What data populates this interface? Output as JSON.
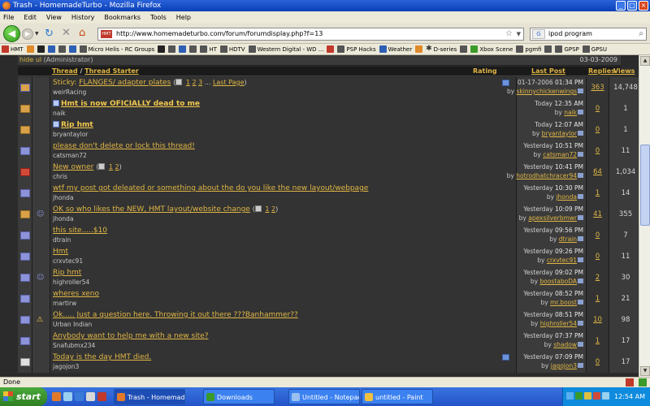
{
  "window": {
    "title": "Trash - HomemadeTurbo - Mozilla Firefox"
  },
  "menu": [
    "File",
    "Edit",
    "View",
    "History",
    "Bookmarks",
    "Tools",
    "Help"
  ],
  "nav": {
    "url": "http://www.homemadeturbo.com/forum/forumdisplay.php?f=13",
    "favicon_text": "HMT",
    "search_value": "ipod program",
    "search_engine": "G"
  },
  "bookmarks": [
    {
      "label": "HMT",
      "icon": "red"
    },
    {
      "label": "",
      "icon": "orange"
    },
    {
      "label": "",
      "icon": "dark"
    },
    {
      "label": "",
      "icon": "blue"
    },
    {
      "label": "",
      "icon": "sq"
    },
    {
      "label": "",
      "icon": "blue"
    },
    {
      "label": "Micro Helis - RC Groups",
      "icon": "sq"
    },
    {
      "label": "",
      "icon": "dark"
    },
    {
      "label": "",
      "icon": "sq"
    },
    {
      "label": "",
      "icon": "blue"
    },
    {
      "label": "",
      "icon": "sq"
    },
    {
      "label": "HT",
      "icon": "sq"
    },
    {
      "label": "HDTV",
      "icon": "sq"
    },
    {
      "label": "Western Digital - WD ...",
      "icon": "sq"
    },
    {
      "label": "",
      "icon": "red"
    },
    {
      "label": "PSP Hacks",
      "icon": "sq"
    },
    {
      "label": "Weather",
      "icon": "blue"
    },
    {
      "label": "",
      "icon": "orange"
    },
    {
      "label": "D-series",
      "icon": "star"
    },
    {
      "label": "",
      "icon": "sq"
    },
    {
      "label": "Xbox Scene",
      "icon": "green"
    },
    {
      "label": "pgmfi",
      "icon": "sq"
    },
    {
      "label": "",
      "icon": "sq"
    },
    {
      "label": "GPSP",
      "icon": "sq"
    },
    {
      "label": "GPSU",
      "icon": "sq"
    }
  ],
  "forum": {
    "admin_text": "(Administrator)",
    "date": "03-03-2009",
    "headers": {
      "thread": "Thread",
      "sep": " / ",
      "thread_starter": "Thread Starter",
      "rating": "Rating",
      "last_post": "Last Post",
      "replies": "Replies",
      "views": "Views"
    },
    "threads": [
      {
        "icon": "sticky",
        "prefix": "Sticky: ",
        "title": "FLANGES/ adapter plates",
        "bold": false,
        "check": false,
        "pages": [
          "1",
          "2",
          "3",
          "...",
          "Last Page"
        ],
        "starter": "weirRacing",
        "date": "01-17-2006",
        "time": "01:34 PM",
        "by": "skinnychickenwings",
        "replies": "363",
        "views": "14,748",
        "rating_icon": true,
        "post_icon": ""
      },
      {
        "icon": "hot",
        "prefix": "",
        "title": "Hmt is now OFICIALLY dead to me",
        "bold": true,
        "check": true,
        "pages": [],
        "starter": "naik",
        "date": "Today",
        "time": "12:35 AM",
        "by": "naik",
        "replies": "0",
        "views": "1",
        "rating_icon": false,
        "post_icon": ""
      },
      {
        "icon": "hot",
        "prefix": "",
        "title": "Rip hmt",
        "bold": true,
        "check": true,
        "pages": [],
        "starter": "bryantaylor",
        "date": "Today",
        "time": "12:07 AM",
        "by": "bryantaylor",
        "replies": "0",
        "views": "1",
        "rating_icon": false,
        "post_icon": ""
      },
      {
        "icon": "norm",
        "prefix": "",
        "title": "please don't delete or lock this thread!",
        "bold": false,
        "check": false,
        "pages": [],
        "starter": "catsman72",
        "date": "Yesterday",
        "time": "10:51 PM",
        "by": "catsman72",
        "replies": "0",
        "views": "11",
        "rating_icon": false,
        "post_icon": ""
      },
      {
        "icon": "red",
        "prefix": "",
        "title": "New owner",
        "bold": false,
        "check": false,
        "pages": [
          "1",
          "2"
        ],
        "starter": "chris",
        "date": "Yesterday",
        "time": "10:41 PM",
        "by": "hotrodhatchracer94",
        "replies": "64",
        "views": "1,034",
        "rating_icon": false,
        "post_icon": ""
      },
      {
        "icon": "norm",
        "prefix": "",
        "title": "wtf my post got deleated or something about the do you like the new layout/webpage",
        "bold": false,
        "check": false,
        "pages": [],
        "starter": "jhonda",
        "date": "Yesterday",
        "time": "10:30 PM",
        "by": "jhonda",
        "replies": "1",
        "views": "14",
        "rating_icon": false,
        "post_icon": ""
      },
      {
        "icon": "hot",
        "prefix": "",
        "title": "OK so who likes the NEW, HMT layout/website change",
        "bold": false,
        "check": false,
        "pages": [
          "1",
          "2"
        ],
        "starter": "jhonda",
        "date": "Yesterday",
        "time": "10:09 PM",
        "by": "apexsilverbmwr",
        "replies": "41",
        "views": "355",
        "rating_icon": false,
        "post_icon": "smile"
      },
      {
        "icon": "norm",
        "prefix": "",
        "title": "this site.....$10",
        "bold": false,
        "check": false,
        "pages": [],
        "starter": "dtrain",
        "date": "Yesterday",
        "time": "09:56 PM",
        "by": "dtrain",
        "replies": "0",
        "views": "7",
        "rating_icon": false,
        "post_icon": ""
      },
      {
        "icon": "norm",
        "prefix": "",
        "title": "Hmt",
        "bold": false,
        "check": false,
        "pages": [],
        "starter": "crxvtec91",
        "date": "Yesterday",
        "time": "09:26 PM",
        "by": "crxvtec91",
        "replies": "0",
        "views": "11",
        "rating_icon": false,
        "post_icon": ""
      },
      {
        "icon": "norm",
        "prefix": "",
        "title": "Rip hmt",
        "bold": false,
        "check": false,
        "pages": [],
        "starter": "highroller54",
        "date": "Yesterday",
        "time": "09:02 PM",
        "by": "boostaboDA",
        "replies": "2",
        "views": "30",
        "rating_icon": false,
        "post_icon": "smile"
      },
      {
        "icon": "norm",
        "prefix": "",
        "title": "wheres xeno",
        "bold": false,
        "check": false,
        "pages": [],
        "starter": "martirw",
        "date": "Yesterday",
        "time": "08:52 PM",
        "by": "mr.boost",
        "replies": "1",
        "views": "21",
        "rating_icon": false,
        "post_icon": ""
      },
      {
        "icon": "norm",
        "prefix": "",
        "title": "Ok..... Just a question here. Throwing it out there ???Banhammer??",
        "bold": false,
        "check": false,
        "pages": [],
        "starter": "Urban Indian",
        "date": "Yesterday",
        "time": "08:51 PM",
        "by": "highroller54",
        "replies": "10",
        "views": "98",
        "rating_icon": false,
        "post_icon": "warn"
      },
      {
        "icon": "norm",
        "prefix": "",
        "title": "Anybody want to help me with a new site?",
        "bold": false,
        "check": false,
        "pages": [],
        "starter": "Snafubmx234",
        "date": "Yesterday",
        "time": "07:37 PM",
        "by": "shadow",
        "replies": "1",
        "views": "17",
        "rating_icon": false,
        "post_icon": ""
      },
      {
        "icon": "lock",
        "prefix": "",
        "title": "Today is the day HMT died.",
        "bold": false,
        "check": false,
        "pages": [],
        "starter": "jagojon3",
        "date": "Yesterday",
        "time": "07:09 PM",
        "by": "jagojon3",
        "replies": "0",
        "views": "17",
        "rating_icon": true,
        "post_icon": ""
      }
    ]
  },
  "status": {
    "text": "Done"
  },
  "taskbar": {
    "start": "start",
    "tasks": [
      {
        "label": "Trash - HomemadeTu...",
        "active": true,
        "color": "#e07a2a"
      },
      {
        "label": "Downloads",
        "active": false,
        "color": "#3a9a2a"
      },
      {
        "label": "Untitled - Notepad",
        "active": false,
        "color": "#9ac0f0"
      },
      {
        "label": "untitled - Paint",
        "active": false,
        "color": "#f0c040"
      }
    ],
    "clock": "12:54 AM"
  }
}
